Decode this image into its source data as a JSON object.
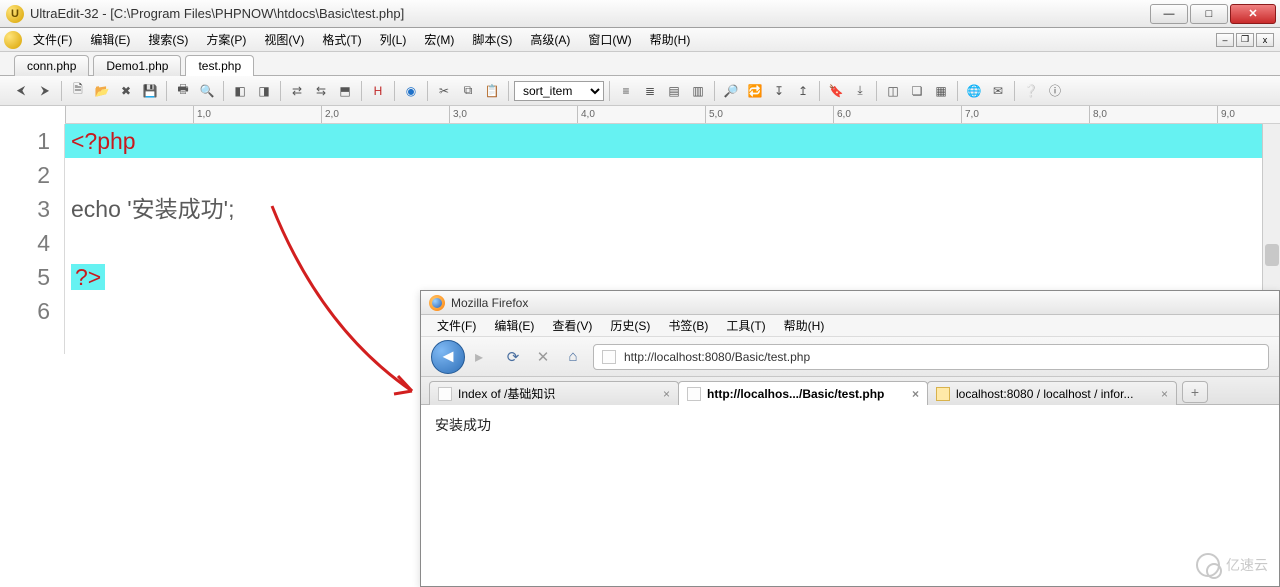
{
  "ue": {
    "title": "UltraEdit-32 - [C:\\Program Files\\PHPNOW\\htdocs\\Basic\\test.php]",
    "app_icon_glyph": "U",
    "menus": [
      "文件(F)",
      "编辑(E)",
      "搜索(S)",
      "方案(P)",
      "视图(V)",
      "格式(T)",
      "列(L)",
      "宏(M)",
      "脚本(S)",
      "高级(A)",
      "窗口(W)",
      "帮助(H)"
    ],
    "file_tabs": [
      "conn.php",
      "Demo1.php",
      "test.php"
    ],
    "active_tab_index": 2,
    "toolbar_combo": "sort_item",
    "ruler_ticks": [
      "",
      "1,0",
      "2,0",
      "3,0",
      "4,0",
      "5,0",
      "6,0",
      "7,0",
      "8,0",
      "9,0"
    ],
    "code": {
      "lines": [
        {
          "n": "1",
          "segments": [
            {
              "t": "<?php",
              "c": "tok-key"
            }
          ],
          "hl": true
        },
        {
          "n": "2",
          "segments": []
        },
        {
          "n": "3",
          "segments": [
            {
              "t": "echo ",
              "c": "tok-plain"
            },
            {
              "t": "'安装成功'",
              "c": "tok-str"
            },
            {
              "t": ";",
              "c": "tok-plain"
            }
          ]
        },
        {
          "n": "4",
          "segments": []
        },
        {
          "n": "5",
          "segments": [
            {
              "t": "?>",
              "c": "tok-key"
            }
          ],
          "hl5": true
        },
        {
          "n": "6",
          "segments": []
        }
      ]
    }
  },
  "ff": {
    "title": "Mozilla Firefox",
    "menus": [
      "文件(F)",
      "编辑(E)",
      "查看(V)",
      "历史(S)",
      "书签(B)",
      "工具(T)",
      "帮助(H)"
    ],
    "url": "http://localhost:8080/Basic/test.php",
    "tabs": [
      {
        "label": "Index of /基础知识",
        "active": false
      },
      {
        "label": "http://localhos.../Basic/test.php",
        "active": true
      },
      {
        "label": "localhost:8080 / localhost / infor...",
        "active": false
      }
    ],
    "page_text": "安装成功"
  },
  "watermark": "亿速云"
}
